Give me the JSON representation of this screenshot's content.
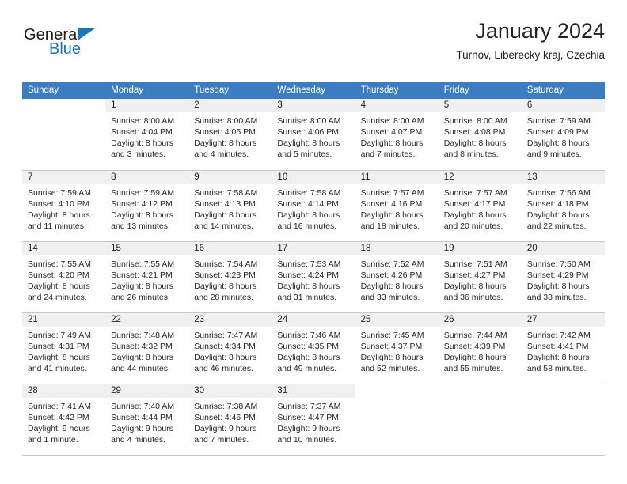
{
  "brand": {
    "name_top": "General",
    "name_bottom": "Blue",
    "triangle_color": "#1b75bb"
  },
  "header": {
    "title": "January 2024",
    "location": "Turnov, Liberecky kraj, Czechia"
  },
  "theme": {
    "header_row_bg": "#3b7dc0",
    "header_row_text": "#ffffff",
    "daynum_band_bg": "#f0f0f0",
    "cell_bg": "#ffffff",
    "grid_line": "#c8c8c8",
    "body_text": "#262626"
  },
  "calendar": {
    "weekday_headers": [
      "Sunday",
      "Monday",
      "Tuesday",
      "Wednesday",
      "Thursday",
      "Friday",
      "Saturday"
    ],
    "weeks": [
      [
        {
          "day": "",
          "blank": true,
          "lines": []
        },
        {
          "day": "1",
          "lines": [
            "Sunrise: 8:00 AM",
            "Sunset: 4:04 PM",
            "Daylight: 8 hours",
            "and 3 minutes."
          ]
        },
        {
          "day": "2",
          "lines": [
            "Sunrise: 8:00 AM",
            "Sunset: 4:05 PM",
            "Daylight: 8 hours",
            "and 4 minutes."
          ]
        },
        {
          "day": "3",
          "lines": [
            "Sunrise: 8:00 AM",
            "Sunset: 4:06 PM",
            "Daylight: 8 hours",
            "and 5 minutes."
          ]
        },
        {
          "day": "4",
          "lines": [
            "Sunrise: 8:00 AM",
            "Sunset: 4:07 PM",
            "Daylight: 8 hours",
            "and 7 minutes."
          ]
        },
        {
          "day": "5",
          "lines": [
            "Sunrise: 8:00 AM",
            "Sunset: 4:08 PM",
            "Daylight: 8 hours",
            "and 8 minutes."
          ]
        },
        {
          "day": "6",
          "lines": [
            "Sunrise: 7:59 AM",
            "Sunset: 4:09 PM",
            "Daylight: 8 hours",
            "and 9 minutes."
          ]
        }
      ],
      [
        {
          "day": "7",
          "lines": [
            "Sunrise: 7:59 AM",
            "Sunset: 4:10 PM",
            "Daylight: 8 hours",
            "and 11 minutes."
          ]
        },
        {
          "day": "8",
          "lines": [
            "Sunrise: 7:59 AM",
            "Sunset: 4:12 PM",
            "Daylight: 8 hours",
            "and 13 minutes."
          ]
        },
        {
          "day": "9",
          "lines": [
            "Sunrise: 7:58 AM",
            "Sunset: 4:13 PM",
            "Daylight: 8 hours",
            "and 14 minutes."
          ]
        },
        {
          "day": "10",
          "lines": [
            "Sunrise: 7:58 AM",
            "Sunset: 4:14 PM",
            "Daylight: 8 hours",
            "and 16 minutes."
          ]
        },
        {
          "day": "11",
          "lines": [
            "Sunrise: 7:57 AM",
            "Sunset: 4:16 PM",
            "Daylight: 8 hours",
            "and 18 minutes."
          ]
        },
        {
          "day": "12",
          "lines": [
            "Sunrise: 7:57 AM",
            "Sunset: 4:17 PM",
            "Daylight: 8 hours",
            "and 20 minutes."
          ]
        },
        {
          "day": "13",
          "lines": [
            "Sunrise: 7:56 AM",
            "Sunset: 4:18 PM",
            "Daylight: 8 hours",
            "and 22 minutes."
          ]
        }
      ],
      [
        {
          "day": "14",
          "lines": [
            "Sunrise: 7:55 AM",
            "Sunset: 4:20 PM",
            "Daylight: 8 hours",
            "and 24 minutes."
          ]
        },
        {
          "day": "15",
          "lines": [
            "Sunrise: 7:55 AM",
            "Sunset: 4:21 PM",
            "Daylight: 8 hours",
            "and 26 minutes."
          ]
        },
        {
          "day": "16",
          "lines": [
            "Sunrise: 7:54 AM",
            "Sunset: 4:23 PM",
            "Daylight: 8 hours",
            "and 28 minutes."
          ]
        },
        {
          "day": "17",
          "lines": [
            "Sunrise: 7:53 AM",
            "Sunset: 4:24 PM",
            "Daylight: 8 hours",
            "and 31 minutes."
          ]
        },
        {
          "day": "18",
          "lines": [
            "Sunrise: 7:52 AM",
            "Sunset: 4:26 PM",
            "Daylight: 8 hours",
            "and 33 minutes."
          ]
        },
        {
          "day": "19",
          "lines": [
            "Sunrise: 7:51 AM",
            "Sunset: 4:27 PM",
            "Daylight: 8 hours",
            "and 36 minutes."
          ]
        },
        {
          "day": "20",
          "lines": [
            "Sunrise: 7:50 AM",
            "Sunset: 4:29 PM",
            "Daylight: 8 hours",
            "and 38 minutes."
          ]
        }
      ],
      [
        {
          "day": "21",
          "lines": [
            "Sunrise: 7:49 AM",
            "Sunset: 4:31 PM",
            "Daylight: 8 hours",
            "and 41 minutes."
          ]
        },
        {
          "day": "22",
          "lines": [
            "Sunrise: 7:48 AM",
            "Sunset: 4:32 PM",
            "Daylight: 8 hours",
            "and 44 minutes."
          ]
        },
        {
          "day": "23",
          "lines": [
            "Sunrise: 7:47 AM",
            "Sunset: 4:34 PM",
            "Daylight: 8 hours",
            "and 46 minutes."
          ]
        },
        {
          "day": "24",
          "lines": [
            "Sunrise: 7:46 AM",
            "Sunset: 4:35 PM",
            "Daylight: 8 hours",
            "and 49 minutes."
          ]
        },
        {
          "day": "25",
          "lines": [
            "Sunrise: 7:45 AM",
            "Sunset: 4:37 PM",
            "Daylight: 8 hours",
            "and 52 minutes."
          ]
        },
        {
          "day": "26",
          "lines": [
            "Sunrise: 7:44 AM",
            "Sunset: 4:39 PM",
            "Daylight: 8 hours",
            "and 55 minutes."
          ]
        },
        {
          "day": "27",
          "lines": [
            "Sunrise: 7:42 AM",
            "Sunset: 4:41 PM",
            "Daylight: 8 hours",
            "and 58 minutes."
          ]
        }
      ],
      [
        {
          "day": "28",
          "lines": [
            "Sunrise: 7:41 AM",
            "Sunset: 4:42 PM",
            "Daylight: 9 hours",
            "and 1 minute."
          ]
        },
        {
          "day": "29",
          "lines": [
            "Sunrise: 7:40 AM",
            "Sunset: 4:44 PM",
            "Daylight: 9 hours",
            "and 4 minutes."
          ]
        },
        {
          "day": "30",
          "lines": [
            "Sunrise: 7:38 AM",
            "Sunset: 4:46 PM",
            "Daylight: 9 hours",
            "and 7 minutes."
          ]
        },
        {
          "day": "31",
          "lines": [
            "Sunrise: 7:37 AM",
            "Sunset: 4:47 PM",
            "Daylight: 9 hours",
            "and 10 minutes."
          ]
        },
        {
          "day": "",
          "blank": true,
          "lines": []
        },
        {
          "day": "",
          "blank": true,
          "lines": []
        },
        {
          "day": "",
          "blank": true,
          "lines": []
        }
      ]
    ]
  }
}
